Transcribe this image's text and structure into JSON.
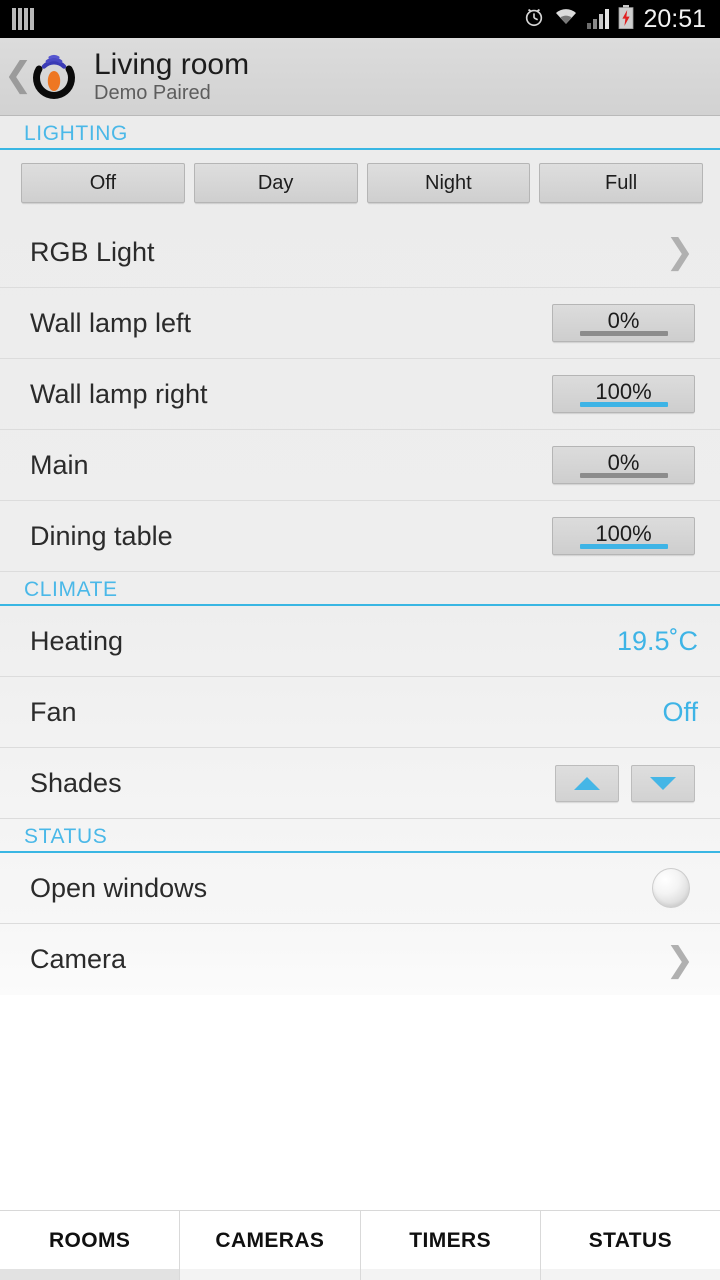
{
  "statusbar": {
    "left_icon": "sim-bars-icon",
    "alarm_icon": "alarm-clock-icon",
    "wifi_icon": "wifi-icon",
    "signal_icon": "cell-signal-icon",
    "battery_icon": "battery-charging-icon",
    "battery_color": "#e02020",
    "clock": "20:51"
  },
  "header": {
    "back_icon": "back-chevron-icon",
    "logo_icon": "app-logo-icon",
    "title": "Living room",
    "subtitle": "Demo Paired"
  },
  "accent_color": "#3eb4e6",
  "sections": [
    {
      "title": "LIGHTING",
      "presets": [
        {
          "label": "Off"
        },
        {
          "label": "Day"
        },
        {
          "label": "Night"
        },
        {
          "label": "Full"
        }
      ],
      "rows": [
        {
          "label": "RGB Light",
          "control": "chevron",
          "chevron": "❯"
        },
        {
          "label": "Wall lamp left",
          "control": "dimmer",
          "value": "0%",
          "level": 0
        },
        {
          "label": "Wall lamp right",
          "control": "dimmer",
          "value": "100%",
          "level": 100
        },
        {
          "label": "Main",
          "control": "dimmer",
          "value": "0%",
          "level": 0
        },
        {
          "label": "Dining table",
          "control": "dimmer",
          "value": "100%",
          "level": 100
        }
      ]
    },
    {
      "title": "CLIMATE",
      "rows": [
        {
          "label": "Heating",
          "control": "value",
          "value": "19.5˚C"
        },
        {
          "label": "Fan",
          "control": "value",
          "value": "Off"
        },
        {
          "label": "Shades",
          "control": "stepper",
          "up_icon": "triangle-up-icon",
          "down_icon": "triangle-down-icon"
        }
      ]
    },
    {
      "title": "STATUS",
      "rows": [
        {
          "label": "Open windows",
          "control": "led",
          "led_state": "off"
        },
        {
          "label": "Camera",
          "control": "chevron",
          "chevron": "❯"
        }
      ]
    }
  ],
  "tabs": [
    {
      "label": "ROOMS",
      "selected": true
    },
    {
      "label": "CAMERAS",
      "selected": false
    },
    {
      "label": "TIMERS",
      "selected": false
    },
    {
      "label": "STATUS",
      "selected": false
    }
  ]
}
